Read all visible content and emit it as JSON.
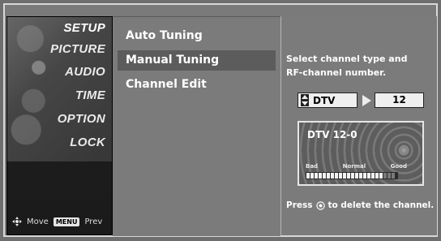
{
  "sidebar": {
    "items": [
      {
        "label": "SETUP",
        "active": true
      },
      {
        "label": "PICTURE",
        "active": false
      },
      {
        "label": "AUDIO",
        "active": false
      },
      {
        "label": "TIME",
        "active": false
      },
      {
        "label": "OPTION",
        "active": false
      },
      {
        "label": "LOCK",
        "active": false
      }
    ],
    "footer": {
      "move_label": "Move",
      "menu_key_label": "MENU",
      "prev_label": "Prev"
    }
  },
  "options": {
    "items": [
      {
        "label": "Auto Tuning",
        "active": false
      },
      {
        "label": "Manual Tuning",
        "active": true
      },
      {
        "label": "Channel Edit",
        "active": false
      }
    ]
  },
  "right_panel": {
    "instructions_line1": "Select channel type and",
    "instructions_line2": "RF-channel number.",
    "channel_type": "DTV",
    "rf_channel": "12",
    "signal": {
      "title": "DTV 12-0",
      "label_bad": "Bad",
      "label_normal": "Normal",
      "label_good": "Good",
      "level_segments_on": 19,
      "level_segments_total": 22
    },
    "press_text_before": "Press",
    "press_text_after": "to delete the channel."
  }
}
